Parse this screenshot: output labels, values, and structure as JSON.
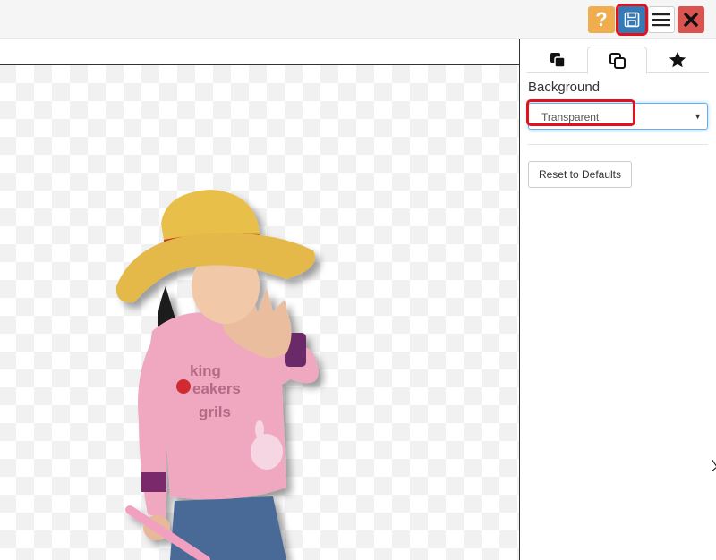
{
  "toolbar": {
    "help_icon": "question-icon",
    "help_glyph": "?",
    "save_icon": "floppy-disk-icon",
    "menu_icon": "hamburger-menu-icon",
    "close_icon": "close-x-icon",
    "colors": {
      "help": "#f0ad4e",
      "save": "#337ab7",
      "close": "#d9534f",
      "highlight": "#e0121b"
    }
  },
  "panel": {
    "tabs": [
      {
        "icon": "layers-icon",
        "active": false
      },
      {
        "icon": "copy-layers-icon",
        "active": true
      },
      {
        "icon": "star-icon",
        "active": false
      }
    ],
    "background_label": "Background",
    "background_select": {
      "value": "Transparent"
    },
    "reset_label": "Reset to Defaults"
  },
  "canvas": {
    "content": "girl-cutout-image",
    "background": "transparent-checkerboard"
  }
}
